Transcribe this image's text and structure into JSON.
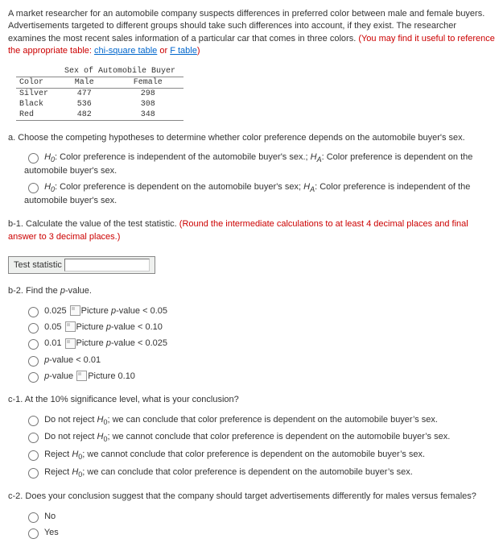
{
  "intro": {
    "text1": "A market researcher for an automobile company suspects differences in preferred color between male and female buyers. Advertisements targeted to different groups should take such differences into account, if they exist. The researcher examines the most recent sales information of a particular car that comes in three colors. ",
    "redPart": "(You may find it useful to reference the appropriate table: ",
    "link1": "chi-square table",
    "or": " or ",
    "link2": "F table",
    "close": ")"
  },
  "table": {
    "groupHeader": "Sex of Automobile Buyer",
    "colHeader": "Color",
    "maleHeader": "Male",
    "femaleHeader": "Female",
    "rows": [
      {
        "label": "Silver",
        "male": "477",
        "female": "298"
      },
      {
        "label": "Black",
        "male": "536",
        "female": "308"
      },
      {
        "label": "Red",
        "male": "482",
        "female": "348"
      }
    ]
  },
  "partA": {
    "prompt": "a. Choose the competing hypotheses to determine whether color preference depends on the automobile buyer's sex.",
    "opt1_h0_label": "H",
    "opt1_h0_sub": "0",
    "opt1_h0_text": ": Color preference is independent of the automobile buyer's sex.; ",
    "opt1_ha_label": "H",
    "opt1_ha_sub": "A",
    "opt1_ha_text": ": Color preference is dependent on the automobile buyer's sex.",
    "opt2_h0_text": ": Color preference is dependent on the automobile buyer's sex; ",
    "opt2_ha_text": ": Color preference is independent of the automobile buyer's sex."
  },
  "partB1": {
    "prompt1": "b-1. Calculate the value of the test statistic. ",
    "promptRed": "(Round the intermediate calculations to at least 4 decimal places and final answer to 3 decimal places.)",
    "boxLabel": "Test statistic"
  },
  "partB2": {
    "prompt": "b-2. Find the ",
    "pvalue": "p",
    "prompt2": "-value.",
    "opts": [
      {
        "pre": "0.025 ",
        "mid": "Picture ",
        "ital_p": "p",
        "post": "-value < 0.05"
      },
      {
        "pre": "0.05 ",
        "mid": "Picture ",
        "ital_p": "p",
        "post": "-value < 0.10"
      },
      {
        "pre": "0.01 ",
        "mid": "Picture ",
        "ital_p": "p",
        "post": "-value < 0.025"
      },
      {
        "pre": "",
        "mid": "",
        "ital_p": "p",
        "post": "-value < 0.01"
      },
      {
        "pre": "",
        "mid": "Picture ",
        "ital_p": "p",
        "post": "-value ",
        "extra": "0.10",
        "picAfterPost": true
      }
    ]
  },
  "partC1": {
    "prompt": "c-1. At the 10% significance level, what is your conclusion?",
    "opts": [
      {
        "a": "Do not reject ",
        "h": "H",
        "s": "0",
        "b": "; we can conclude that color preference is dependent on the automobile buyer’s sex."
      },
      {
        "a": "Do not reject ",
        "h": "H",
        "s": "0",
        "b": "; we cannot conclude that color preference is dependent on the automobile buyer’s sex."
      },
      {
        "a": "Reject ",
        "h": "H",
        "s": "0",
        "b": "; we cannot conclude that color preference is dependent on the automobile buyer’s sex."
      },
      {
        "a": "Reject ",
        "h": "H",
        "s": "0",
        "b": "; we can conclude that color preference is dependent on the automobile buyer’s sex."
      }
    ]
  },
  "partC2": {
    "prompt": "c-2. Does your conclusion suggest that the company should target advertisements differently for males versus females?",
    "no": "No",
    "yes": "Yes"
  }
}
